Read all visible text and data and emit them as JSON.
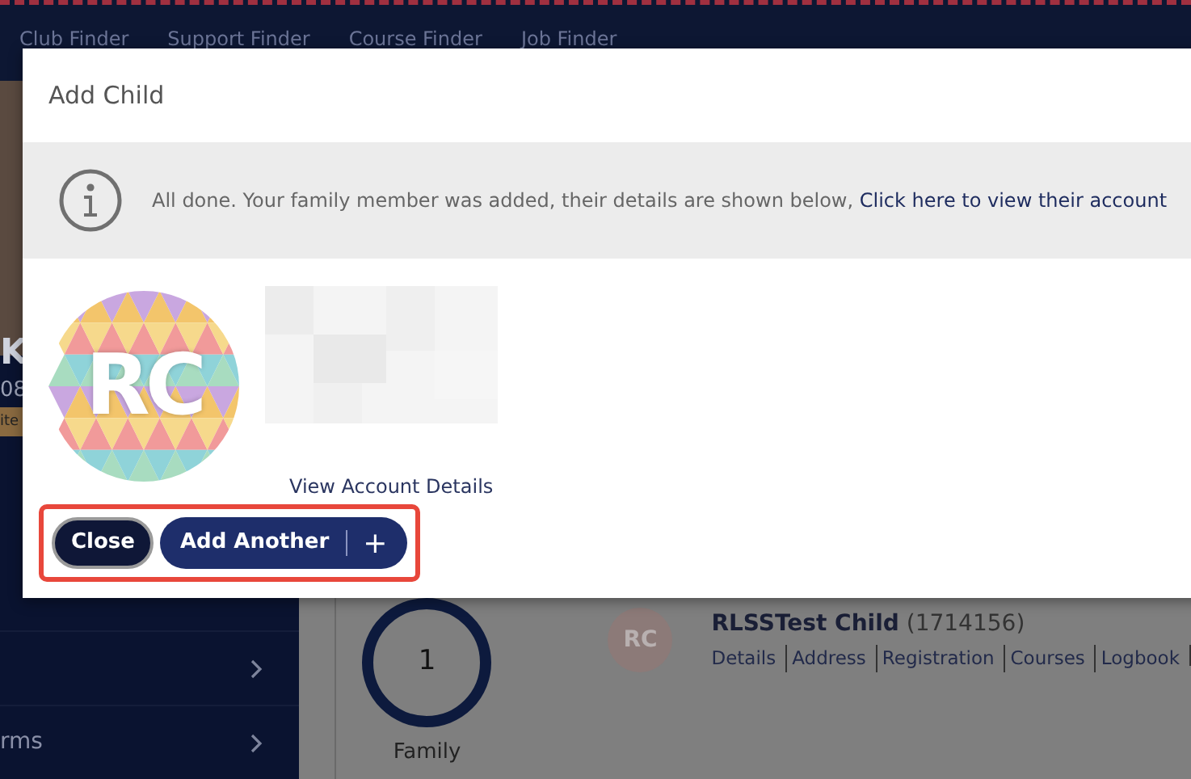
{
  "nav": {
    "links": [
      "Club Finder",
      "Support Finder",
      "Course Finder",
      "Job Finder"
    ]
  },
  "sidebar": {
    "fragments": [
      "K",
      "08",
      "ite"
    ],
    "items": [
      {
        "kind": "link"
      },
      {
        "kind": "link",
        "label": "rms"
      }
    ]
  },
  "summary": {
    "count": "1",
    "label": "Family"
  },
  "member": {
    "initials": "RC",
    "name": "RLSSTest Child",
    "id": "(1714156)",
    "links": [
      "Details",
      "Address",
      "Registration",
      "Courses",
      "Logbook"
    ]
  },
  "modal": {
    "title": "Add Child",
    "message": "All done. Your family member was added, their details are shown below,",
    "message_link": "Click here to view their account",
    "avatar_initials": "RC",
    "view_link": "View Account Details",
    "buttons": [
      {
        "kind": "close",
        "label": "Close"
      },
      {
        "kind": "add",
        "label": "Add Another",
        "icon": "+"
      }
    ],
    "highlighted": true
  }
}
